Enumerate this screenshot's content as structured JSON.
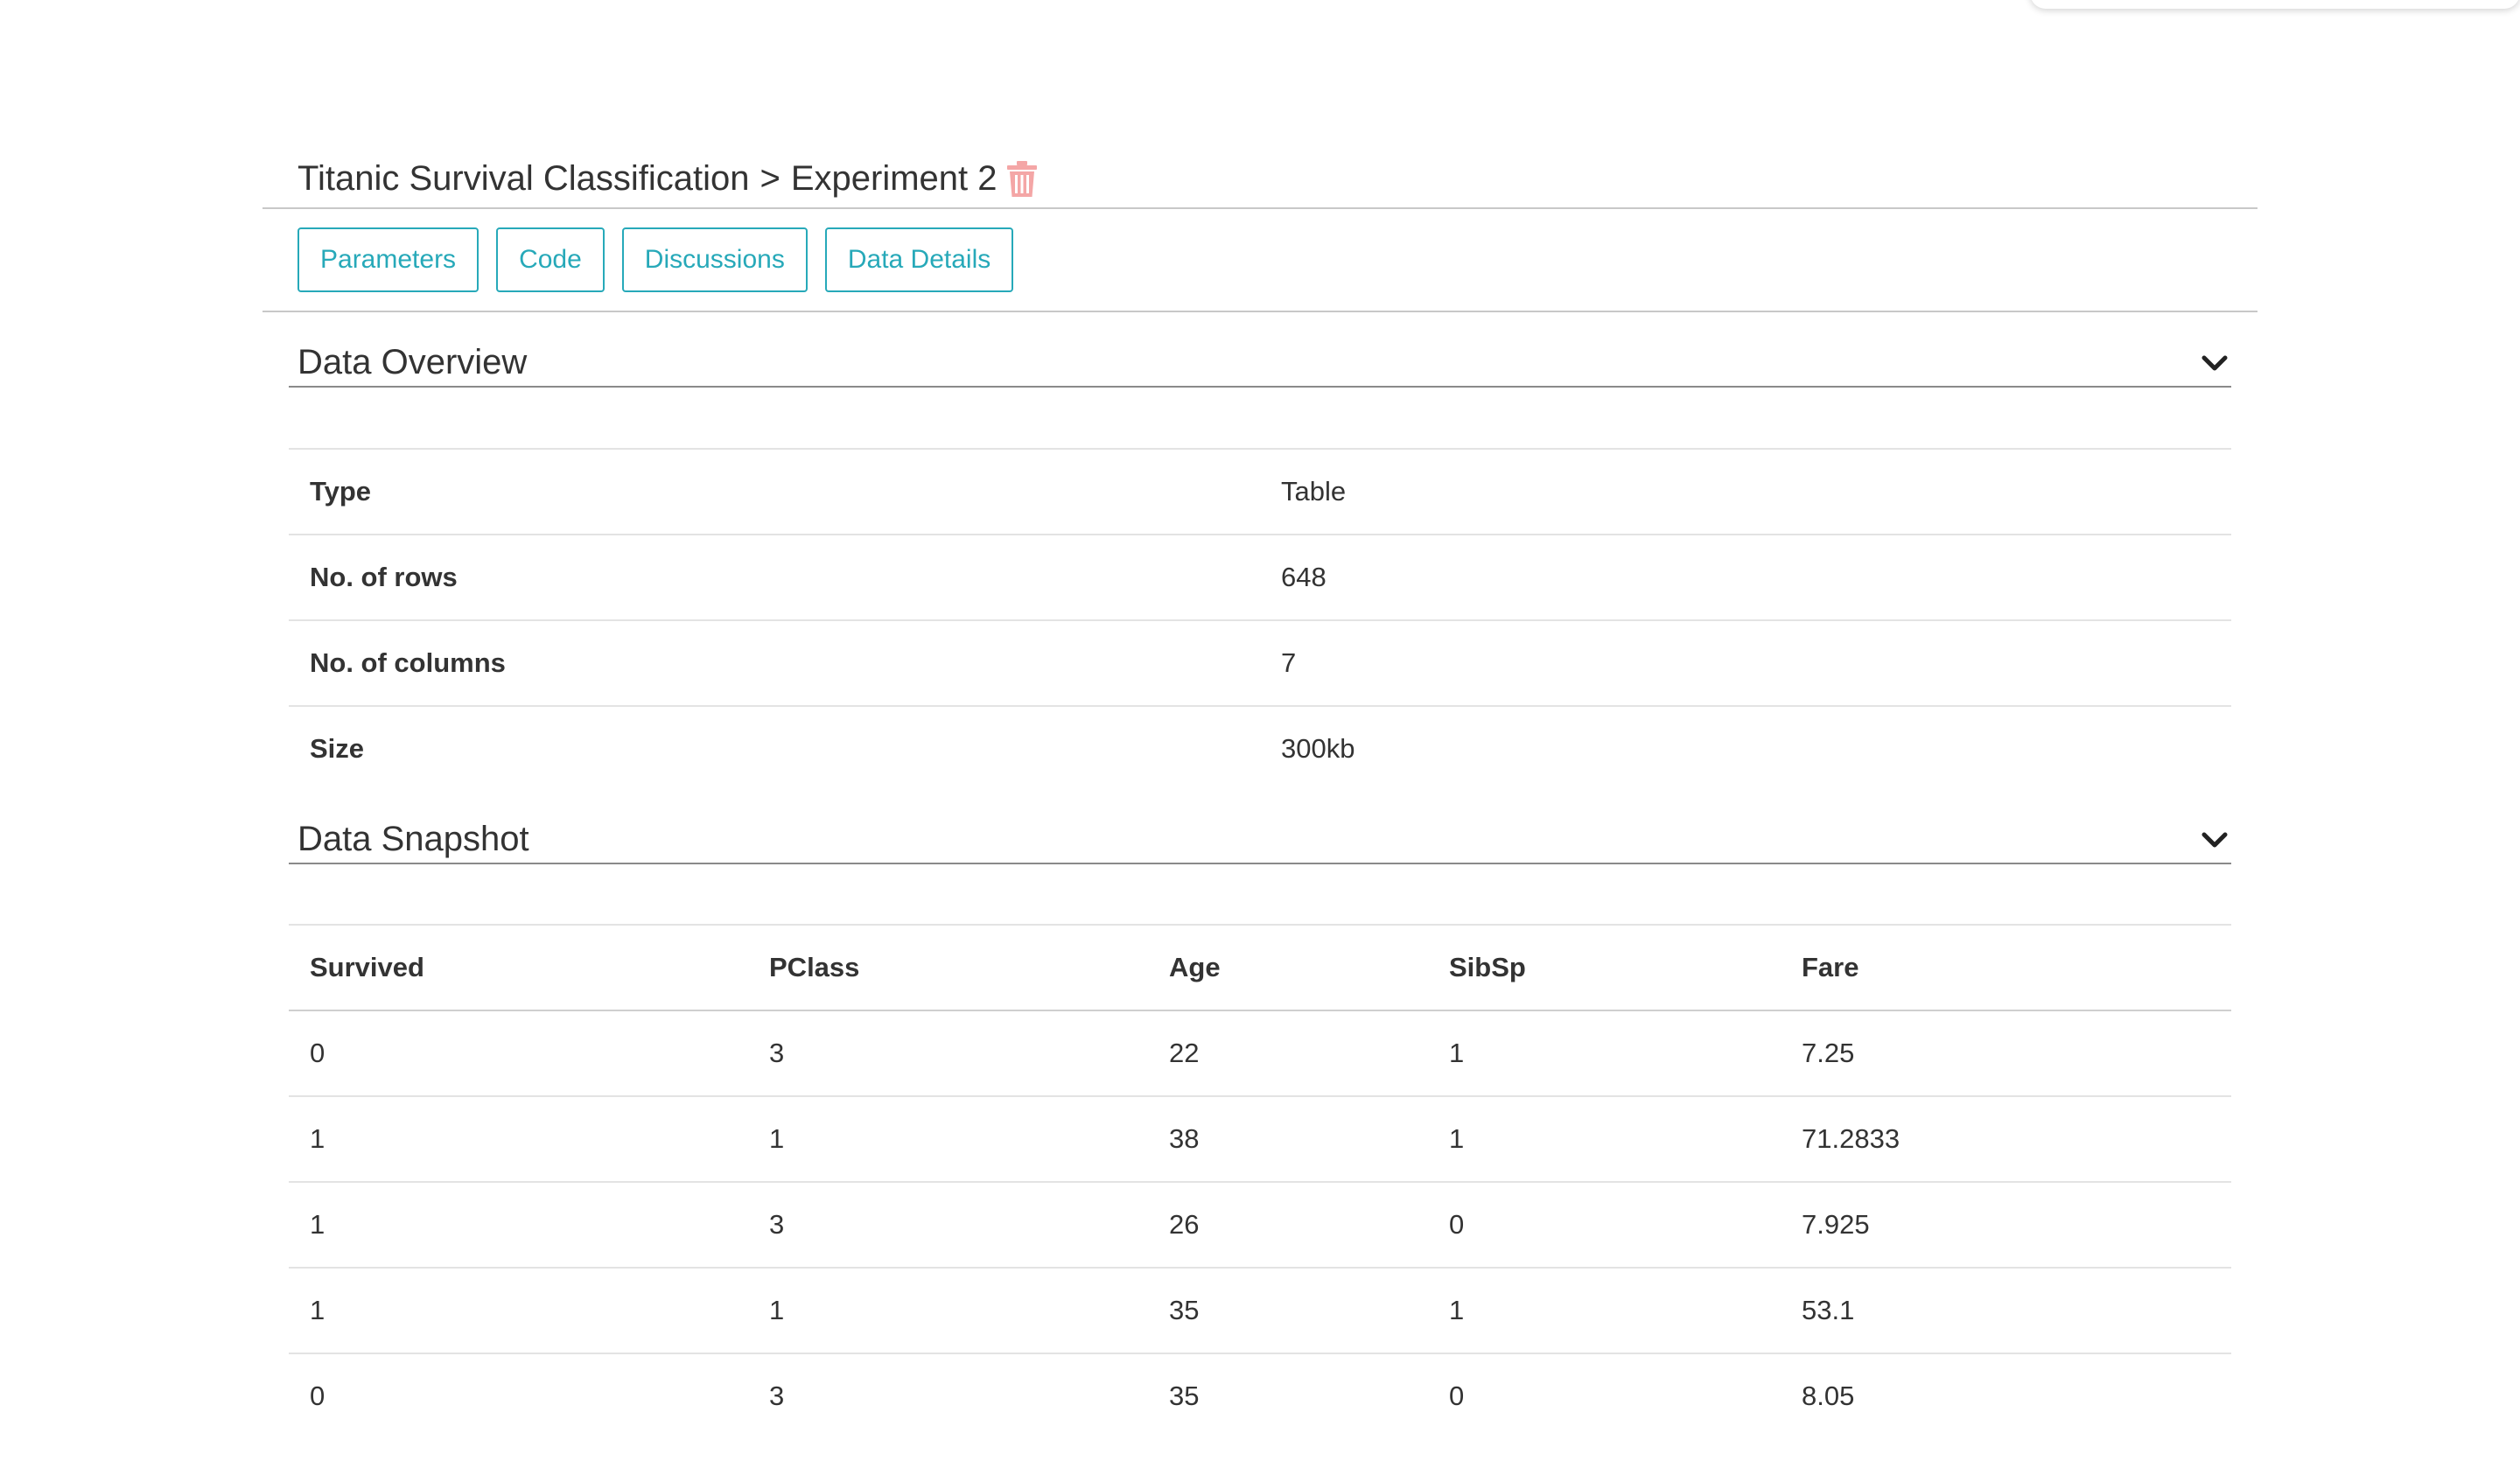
{
  "breadcrumb": {
    "project": "Titanic Survival Classification",
    "separator": ">",
    "experiment": "Experiment 2"
  },
  "icons": {
    "delete": "trash-icon",
    "collapse": "chevron-down-icon"
  },
  "colors": {
    "accent": "#27a9b9",
    "trash": "#f4a6a6"
  },
  "tabs": [
    "Parameters",
    "Code",
    "Discussions",
    "Data Details"
  ],
  "overview": {
    "title": "Data Overview",
    "rows": [
      {
        "label": "Type",
        "value": "Table"
      },
      {
        "label": "No. of rows",
        "value": "648"
      },
      {
        "label": "No. of columns",
        "value": "7"
      },
      {
        "label": "Size",
        "value": "300kb"
      }
    ]
  },
  "snapshot": {
    "title": "Data Snapshot",
    "columns": [
      "Survived",
      "PClass",
      "Age",
      "SibSp",
      "Fare"
    ],
    "rows": [
      [
        "0",
        "3",
        "22",
        "1",
        "7.25"
      ],
      [
        "1",
        "1",
        "38",
        "1",
        "71.2833"
      ],
      [
        "1",
        "3",
        "26",
        "0",
        "7.925"
      ],
      [
        "1",
        "1",
        "35",
        "1",
        "53.1"
      ],
      [
        "0",
        "3",
        "35",
        "0",
        "8.05"
      ]
    ]
  }
}
